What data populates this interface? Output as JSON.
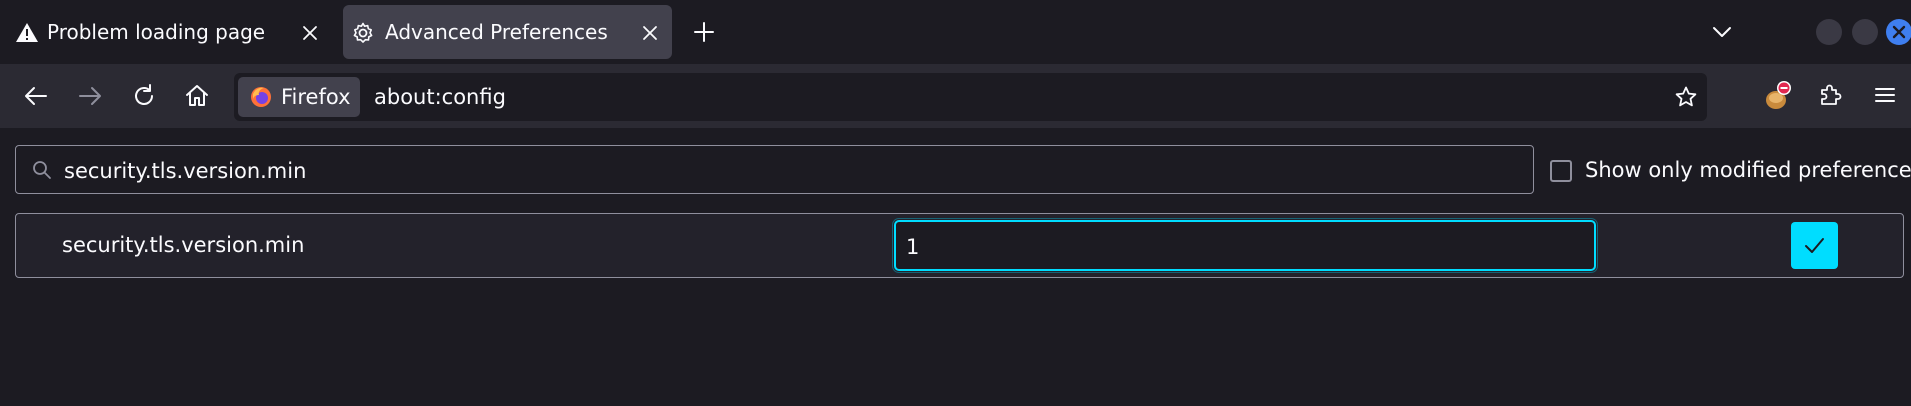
{
  "tabs": [
    {
      "label": "Problem loading page",
      "icon": "warning-icon",
      "active": false
    },
    {
      "label": "Advanced Preferences",
      "icon": "gear-icon",
      "active": true
    }
  ],
  "navbar": {
    "identity_label": "Firefox",
    "url": "about:config"
  },
  "search": {
    "value": "security.tls.version.min",
    "checkbox_label": "Show only modified preferences",
    "checkbox_checked": false
  },
  "pref_row": {
    "name": "security.tls.version.min",
    "value": "1"
  },
  "colors": {
    "accent": "#00ddff",
    "tab_active": "#42414d",
    "toolbar": "#2b2a33",
    "page_bg": "#1c1b22"
  }
}
